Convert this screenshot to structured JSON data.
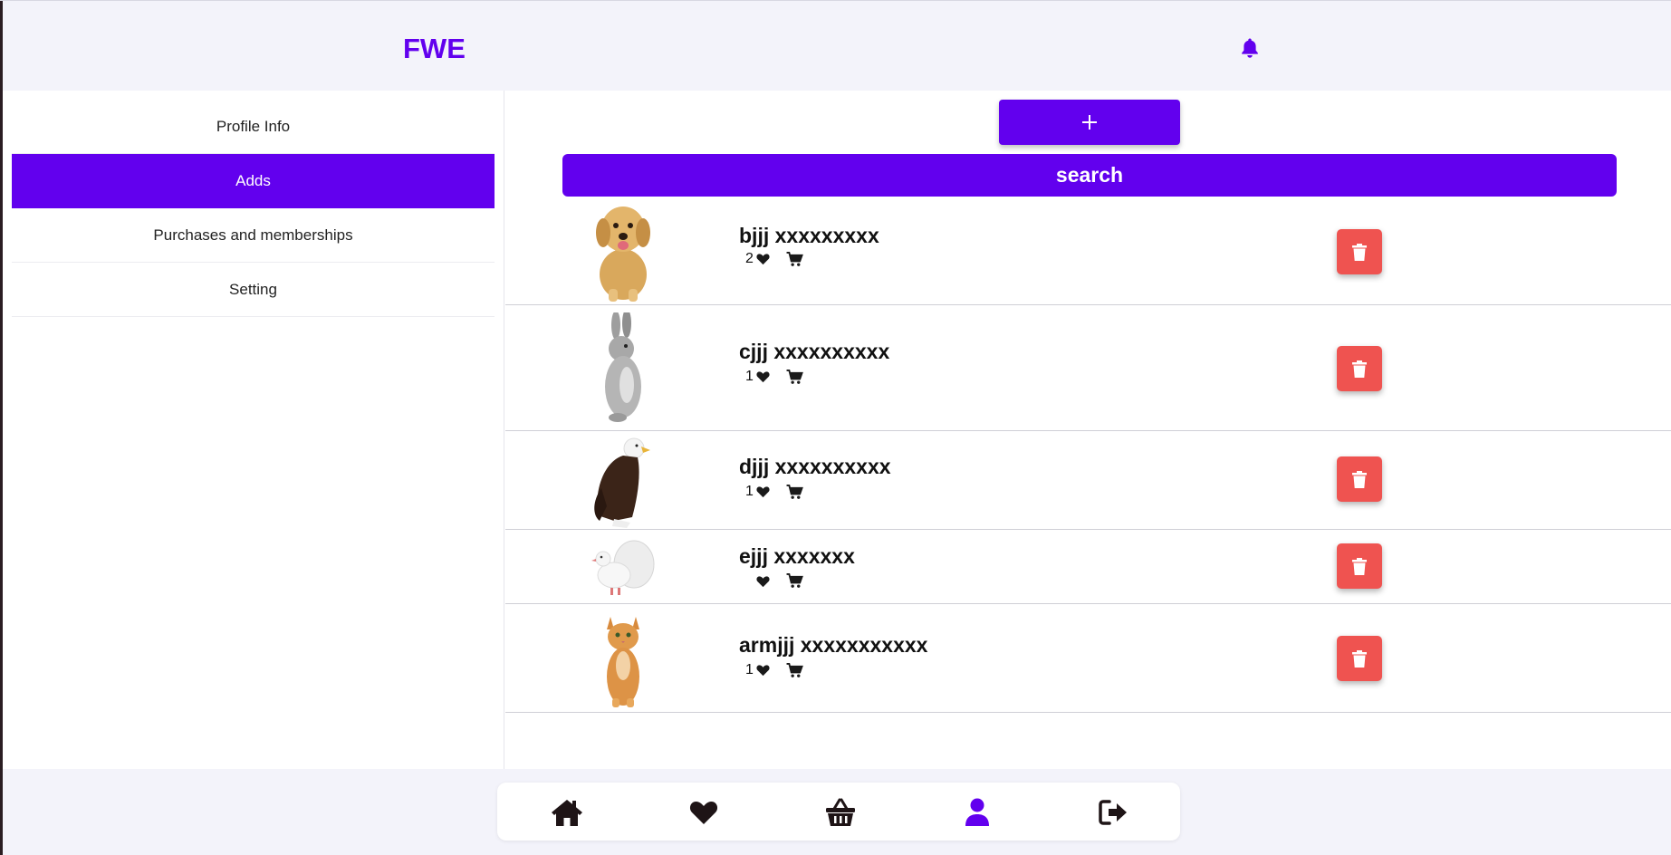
{
  "header": {
    "brand": "FWE",
    "notification_icon": "bell-icon"
  },
  "sidebar": {
    "items": [
      {
        "label": "Profile Info",
        "active": false
      },
      {
        "label": "Adds",
        "active": true
      },
      {
        "label": "Purchases and memberships",
        "active": false
      },
      {
        "label": "Setting",
        "active": false
      }
    ]
  },
  "content": {
    "add_button_label": "+",
    "search_label": "search",
    "ads": [
      {
        "title": "bjjj xxxxxxxxx",
        "likes": "2",
        "animal": "puppy"
      },
      {
        "title": "cjjj xxxxxxxxxx",
        "likes": "1",
        "animal": "rabbit"
      },
      {
        "title": "djjj xxxxxxxxxx",
        "likes": "1",
        "animal": "eagle"
      },
      {
        "title": "ejjj xxxxxxx",
        "likes": "",
        "animal": "dove"
      },
      {
        "title": "armjjj xxxxxxxxxxx",
        "likes": "1",
        "animal": "cat"
      }
    ]
  },
  "bottom_nav": {
    "items": [
      {
        "icon": "home-icon",
        "active": false
      },
      {
        "icon": "heart-icon",
        "active": false
      },
      {
        "icon": "basket-icon",
        "active": false
      },
      {
        "icon": "user-icon",
        "active": true
      },
      {
        "icon": "logout-icon",
        "active": false
      }
    ]
  },
  "colors": {
    "accent": "#6200ee",
    "danger": "#ef5350",
    "background": "#f3f3fa"
  }
}
